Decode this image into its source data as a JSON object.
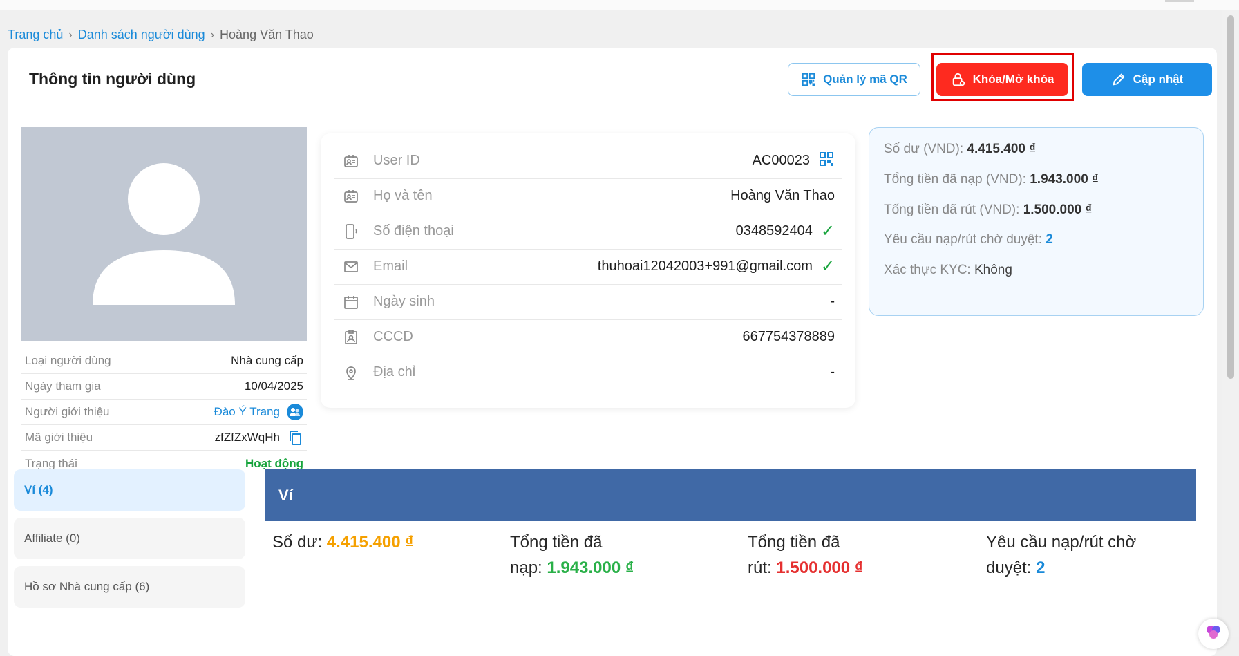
{
  "breadcrumb": {
    "home": "Trang chủ",
    "list": "Danh sách người dùng",
    "current": "Hoàng Văn Thao",
    "separator": "›"
  },
  "header": {
    "title": "Thông tin người dùng",
    "qr_button": "Quản lý mã QR",
    "lock_button": "Khóa/Mở khóa",
    "update_button": "Cập nhật"
  },
  "profile_meta": [
    {
      "label": "Loại người dùng",
      "value": "Nhà cung cấp"
    },
    {
      "label": "Ngày tham gia",
      "value": "10/04/2025"
    },
    {
      "label": "Người giới thiệu",
      "value": "Đào Ý Trang"
    },
    {
      "label": "Mã giới thiệu",
      "value": "zfZfZxWqHh"
    },
    {
      "label": "Trạng thái",
      "value": "Hoạt động"
    }
  ],
  "info": [
    {
      "label": "User ID",
      "value": "AC00023",
      "icon": "id-card-icon"
    },
    {
      "label": "Họ và tên",
      "value": "Hoàng Văn Thao",
      "icon": "id-card-icon"
    },
    {
      "label": "Số điện thoại",
      "value": "0348592404",
      "icon": "phone-icon",
      "verified": true
    },
    {
      "label": "Email",
      "value": "thuhoai12042003+991@gmail.com",
      "icon": "mail-icon",
      "verified": true
    },
    {
      "label": "Ngày sinh",
      "value": "-",
      "icon": "calendar-icon"
    },
    {
      "label": "CCCD",
      "value": "667754378889",
      "icon": "id-badge-icon"
    },
    {
      "label": "Địa chỉ",
      "value": "-",
      "icon": "location-pin-icon"
    }
  ],
  "stats": {
    "balance_label": "Số dư (VND):",
    "balance_value": "4.415.400 ₫",
    "deposit_label": "Tổng tiền đã nạp (VND):",
    "deposit_value": "1.943.000 ₫",
    "withdraw_label": "Tổng tiền đã rút (VND):",
    "withdraw_value": "1.500.000 ₫",
    "pending_label": "Yêu cầu nạp/rút chờ duyệt:",
    "pending_value": "2",
    "kyc_label": "Xác thực KYC:",
    "kyc_value": "Không"
  },
  "tabs": [
    {
      "label": "Ví (4)",
      "active": true
    },
    {
      "label": "Affiliate (0)",
      "active": false
    },
    {
      "label": "Hồ sơ Nhà cung cấp (6)",
      "active": false
    }
  ],
  "wallet": {
    "title": "Ví",
    "balance_label": "Số dư:",
    "balance_value": "4.415.400 ₫",
    "deposit_label_1": "Tổng tiền đã",
    "deposit_label_2": "nạp:",
    "deposit_value": "1.943.000 ₫",
    "withdraw_label_1": "Tổng tiền đã",
    "withdraw_label_2": "rút:",
    "withdraw_value": "1.500.000 ₫",
    "pending_label_1": "Yêu cầu nạp/rút chờ",
    "pending_label_2": "duyệt:",
    "pending_value": "2"
  },
  "colors": {
    "accent": "#1a8ad9",
    "danger": "#fe2a1f",
    "success": "#17a43c",
    "wallet_header": "#4069a6"
  }
}
